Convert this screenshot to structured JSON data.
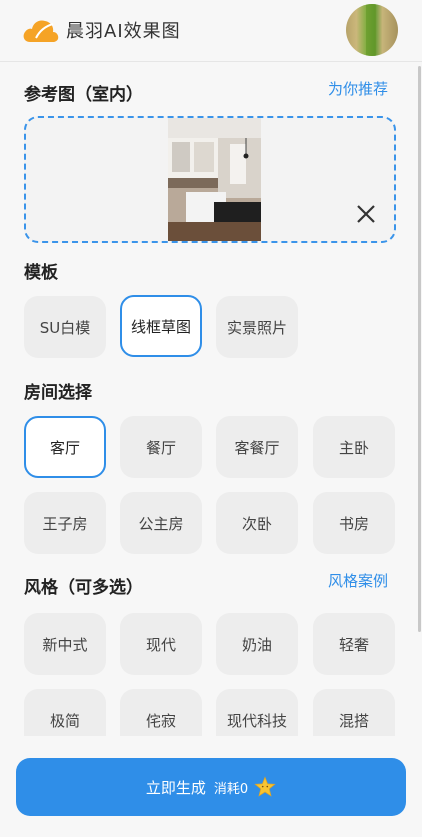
{
  "header": {
    "app_title": "晨羽AI效果图"
  },
  "reference": {
    "title": "参考图（室内）",
    "recommend_link": "为你推荐"
  },
  "template": {
    "title": "模板",
    "options": [
      "SU白模",
      "线框草图",
      "实景照片"
    ],
    "selected": "线框草图"
  },
  "room": {
    "title": "房间选择",
    "options": [
      "客厅",
      "餐厅",
      "客餐厅",
      "主卧",
      "王子房",
      "公主房",
      "次卧",
      "书房"
    ],
    "selected": "客厅"
  },
  "style": {
    "title": "风格（可多选）",
    "cases_link": "风格案例",
    "options": [
      "新中式",
      "现代",
      "奶油",
      "轻奢",
      "极简",
      "侘寂",
      "现代科技",
      "混搭"
    ]
  },
  "footer": {
    "generate_label": "立即生成",
    "cost_label": "消耗0"
  },
  "colors": {
    "accent": "#2f8ee8",
    "logo": "#f5a326"
  }
}
